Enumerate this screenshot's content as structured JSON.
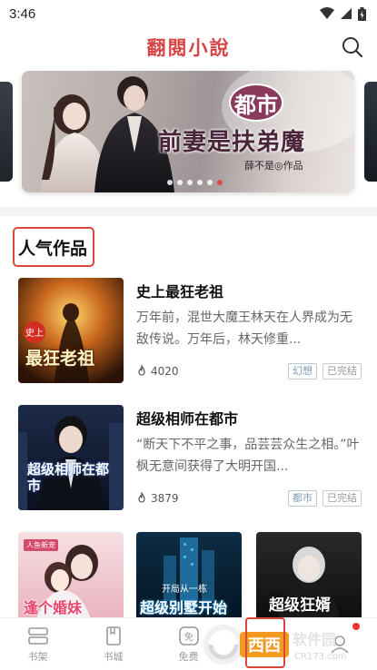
{
  "status_bar": {
    "time": "3:46"
  },
  "app": {
    "title": "翻閱小說"
  },
  "banner": {
    "tag": "都市",
    "title": "前妻是扶弟魔",
    "author": "薛不是◎作品",
    "dot_count": 6,
    "active_dot": 5
  },
  "section": {
    "title": "人气作品"
  },
  "books": [
    {
      "title": "史上最狂老祖",
      "desc": "万年前，混世大魔王林天在人界成为无敌传说。万年后，林天修重...",
      "heat": "4020",
      "genre": "幻想",
      "status": "已完结",
      "cover_text": "最狂老祖"
    },
    {
      "title": "超级相师在都市",
      "desc": "“断天下不平之事，品芸芸众生之相。”叶枫无意间获得了大明开国...",
      "heat": "3879",
      "genre": "都市",
      "status": "已完结",
      "cover_text": "超级相师在都市"
    }
  ],
  "grid_covers": [
    {
      "text": "逢个婚妹",
      "caption": "人鱼新宠"
    },
    {
      "text": "超级别墅开始",
      "caption": "开局从一栋"
    },
    {
      "text": "超级狂婿",
      "caption": ""
    }
  ],
  "nav": {
    "items": [
      {
        "label": "书架",
        "icon": "bookshelf-icon"
      },
      {
        "label": "书城",
        "icon": "bookstore-icon"
      },
      {
        "label": "免费",
        "icon": "free-icon"
      },
      {
        "label": "",
        "icon": "category-icon"
      },
      {
        "label": "",
        "icon": "profile-icon"
      }
    ]
  },
  "watermark": {
    "text": "软件园",
    "site": "CR173.com"
  },
  "colors": {
    "accent": "#d54545",
    "highlight": "#d9483b",
    "tag_blue": "#7a9ab8"
  }
}
